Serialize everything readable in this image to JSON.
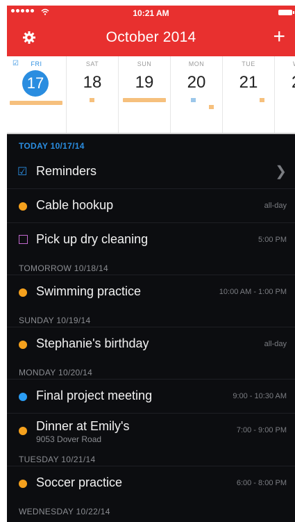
{
  "status": {
    "time": "10:21 AM"
  },
  "header": {
    "title": "October 2014",
    "settings_icon": "gear-icon",
    "add_icon": "plus-icon",
    "accent": "#e8302f"
  },
  "week": [
    {
      "name": "FRI",
      "num": "17",
      "selected": true
    },
    {
      "name": "SAT",
      "num": "18"
    },
    {
      "name": "SUN",
      "num": "19"
    },
    {
      "name": "MON",
      "num": "20"
    },
    {
      "name": "TUE",
      "num": "21"
    },
    {
      "name": "W",
      "num": "2"
    }
  ],
  "agenda": {
    "sections": [
      {
        "label": "TODAY 10/17/14"
      },
      {
        "label": "TOMORROW 10/18/14"
      },
      {
        "label": "SUNDAY 10/19/14"
      },
      {
        "label": "MONDAY 10/20/14"
      },
      {
        "label": "TUESDAY 10/21/14"
      },
      {
        "label": "WEDNESDAY 10/22/14"
      }
    ],
    "items": [
      {
        "title": "Reminders",
        "type": "reminders"
      },
      {
        "title": "Cable hookup",
        "time": "all-day",
        "color": "orange"
      },
      {
        "title": "Pick up dry cleaning",
        "time": "5:00 PM",
        "type": "task"
      },
      {
        "title": "Swimming practice",
        "time": "10:00 AM - 1:00 PM",
        "color": "orange"
      },
      {
        "title": "Stephanie's birthday",
        "time": "all-day",
        "color": "orange"
      },
      {
        "title": "Final project meeting",
        "time": "9:00 - 10:30 AM",
        "color": "blue"
      },
      {
        "title": "Dinner at Emily's",
        "subtitle": "9053 Dover Road",
        "time": "7:00 - 9:00 PM",
        "color": "orange"
      },
      {
        "title": "Soccer practice",
        "time": "6:00 - 8:00 PM",
        "color": "orange"
      }
    ]
  }
}
